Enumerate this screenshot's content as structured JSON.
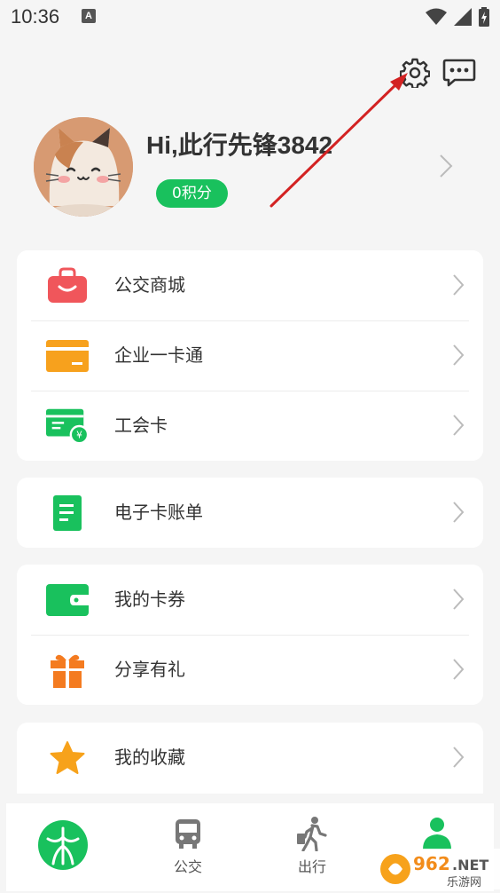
{
  "status_bar": {
    "time": "10:36",
    "indicator": "A"
  },
  "profile": {
    "greeting": "Hi,此行先锋3842",
    "points": "0积分"
  },
  "menu_group_1": [
    {
      "label": "公交商城",
      "icon": "shopping-bag-icon"
    },
    {
      "label": "企业一卡通",
      "icon": "card-icon"
    },
    {
      "label": "工会卡",
      "icon": "union-card-icon"
    }
  ],
  "menu_group_2": [
    {
      "label": "电子卡账单",
      "icon": "bill-icon"
    }
  ],
  "menu_group_3": [
    {
      "label": "我的卡券",
      "icon": "wallet-icon"
    },
    {
      "label": "分享有礼",
      "icon": "gift-icon"
    }
  ],
  "menu_group_4": [
    {
      "label": "我的收藏",
      "icon": "star-icon"
    }
  ],
  "tabs": [
    {
      "label": "",
      "icon": "home-logo-icon"
    },
    {
      "label": "公交",
      "icon": "bus-icon"
    },
    {
      "label": "出行",
      "icon": "walking-icon"
    },
    {
      "label": "",
      "icon": "user-icon"
    }
  ],
  "watermark": {
    "text": "962.NET",
    "subtext": "乐游网"
  },
  "colors": {
    "accent": "#19c15d",
    "background": "#f5f5f5",
    "annotation_arrow": "#d32222",
    "shop_icon": "#f0565b",
    "card_icon": "#f7a11d",
    "gift_icon": "#f47b20",
    "star_icon": "#f7a21b"
  }
}
